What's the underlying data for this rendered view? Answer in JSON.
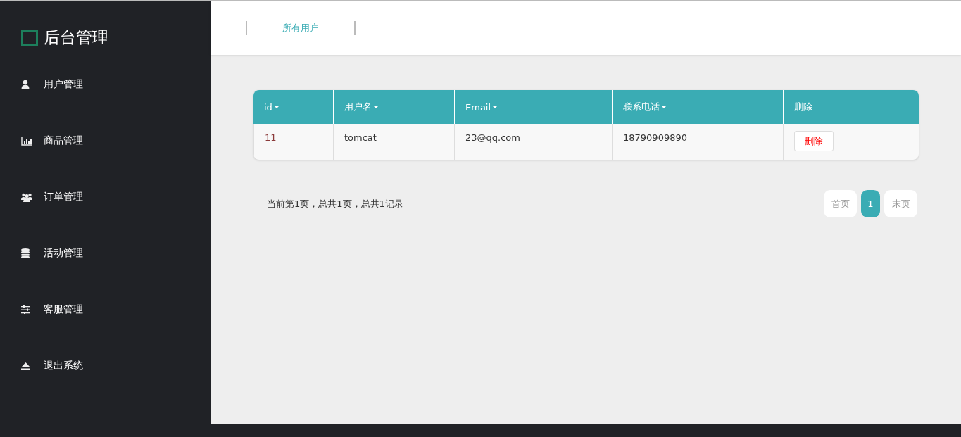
{
  "sidebar": {
    "title": "后台管理",
    "items": [
      {
        "label": "用户管理"
      },
      {
        "label": "商品管理"
      },
      {
        "label": "订单管理"
      },
      {
        "label": "活动管理"
      },
      {
        "label": "客服管理"
      },
      {
        "label": "退出系统"
      }
    ]
  },
  "header": {
    "tabs": [
      {
        "label": "所有用户"
      }
    ]
  },
  "table": {
    "columns": [
      {
        "label": "id",
        "sortable": true
      },
      {
        "label": "用户名",
        "sortable": true
      },
      {
        "label": "Email",
        "sortable": true
      },
      {
        "label": "联系电话",
        "sortable": true
      },
      {
        "label": "删除",
        "sortable": false
      }
    ],
    "rows": [
      {
        "id": "11",
        "username": "tomcat",
        "email": "23@qq.com",
        "phone": "18790909890",
        "action": "删除"
      }
    ]
  },
  "pagination": {
    "summary": "当前第1页，总共1页，总共1记录",
    "pages": [
      {
        "label": "首页",
        "kind": "nav",
        "selected": false
      },
      {
        "label": "1",
        "kind": "page",
        "selected": true
      },
      {
        "label": "末页",
        "kind": "nav",
        "selected": false
      }
    ]
  }
}
